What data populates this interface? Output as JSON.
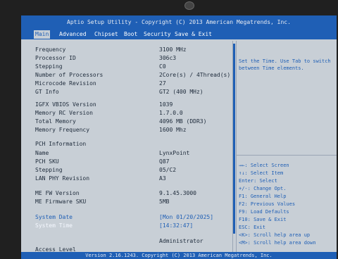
{
  "header": {
    "title": "Aptio Setup Utility - Copyright (C) 2013 American Megatrends, Inc."
  },
  "tabs": [
    {
      "label": "Main",
      "active": true
    },
    {
      "label": "Advanced"
    },
    {
      "label": "Chipset"
    },
    {
      "label": "Boot"
    },
    {
      "label": "Security"
    },
    {
      "label": "Save & Exit"
    }
  ],
  "main": {
    "processor": [
      {
        "label": "Frequency",
        "value": "3100 MHz"
      },
      {
        "label": "Processor ID",
        "value": "306c3"
      },
      {
        "label": "Stepping",
        "value": "C0"
      },
      {
        "label": "Number of Processors",
        "value": "2Core(s) / 4Thread(s)"
      },
      {
        "label": "Microcode Revision",
        "value": "27"
      },
      {
        "label": "GT Info",
        "value": "GT2 (400 MHz)"
      }
    ],
    "memory": [
      {
        "label": "IGFX VBIOS Version",
        "value": "1039"
      },
      {
        "label": "Memory RC Version",
        "value": "1.7.0.0"
      },
      {
        "label": "Total Memory",
        "value": "4096 MB (DDR3)"
      },
      {
        "label": "Memory Frequency",
        "value": "1600 Mhz"
      }
    ],
    "pch_header": "PCH Information",
    "pch": [
      {
        "label": "Name",
        "value": "LynxPoint"
      },
      {
        "label": "PCH SKU",
        "value": "Q87"
      },
      {
        "label": "Stepping",
        "value": "05/C2"
      },
      {
        "label": "LAN PHY Revision",
        "value": "A3"
      }
    ],
    "me": [
      {
        "label": "ME FW Version",
        "value": "9.1.45.3000"
      },
      {
        "label": "ME Firmware SKU",
        "value": "5MB"
      }
    ],
    "system_date_label": "System Date",
    "system_date_value": "[Mon 01/20/2025]",
    "system_time_label": "System Time",
    "system_time_value": "[14:32:47]",
    "access_label": "Access Level",
    "access_value": "Administrator"
  },
  "help": {
    "text": "Set the Time. Use Tab to switch between Time elements.",
    "keys": [
      "→←: Select Screen",
      "↑↓: Select Item",
      "Enter: Select",
      "+/-: Change Opt.",
      "F1: General Help",
      "F2: Previous Values",
      "F9: Load Defaults",
      "F10: Save & Exit",
      "ESC: Exit",
      "<K>: Scroll help area up",
      "<M>: Scroll help area down"
    ]
  },
  "footer": {
    "text": "Version 2.16.1243. Copyright (C) 2013 American Megatrends, Inc."
  },
  "colors": {
    "bios_blue": "#1f5fb5",
    "bios_gray": "#c8cfd6"
  }
}
